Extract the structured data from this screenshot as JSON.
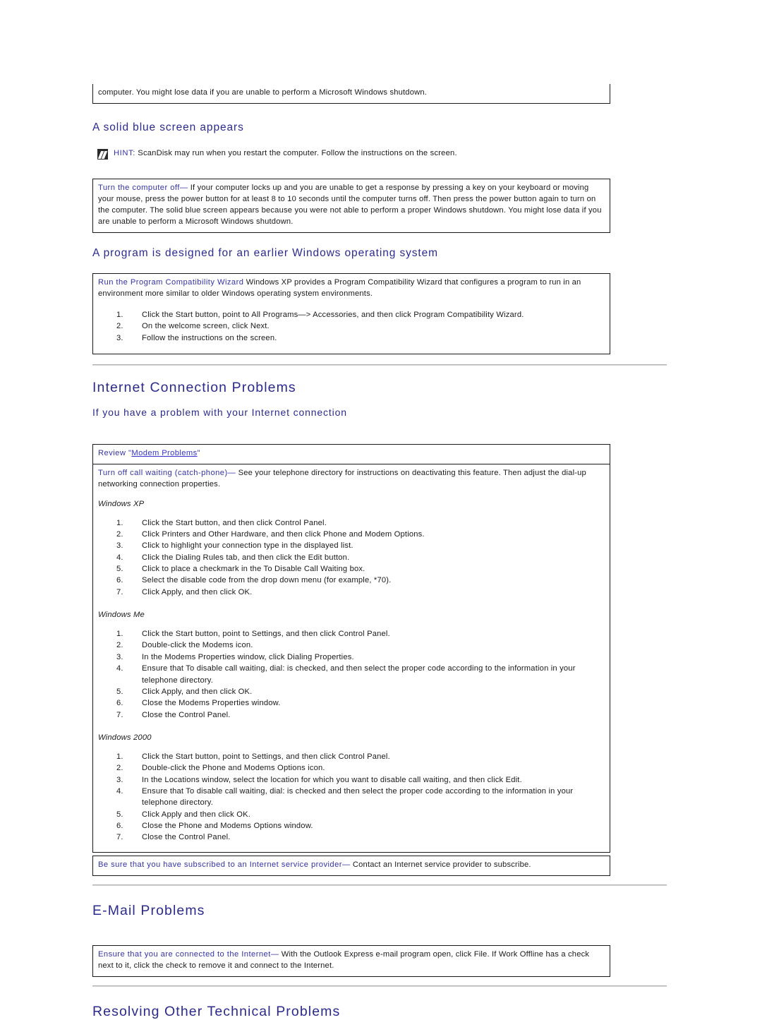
{
  "document": {
    "continued_paragraph": "computer. You might lose data if you are unable to perform a Microsoft Windows shutdown."
  },
  "blue_screen_section": {
    "heading": "A solid blue screen appears",
    "hint": {
      "icon": "note-pencil-icon",
      "keyword": "HINT:",
      "text": " ScanDisk may run when you restart the computer. Follow the instructions on the screen."
    },
    "tip": {
      "label": "Turn the computer off",
      "dash": "—",
      "body": " If your computer locks up and you are unable to get a response by pressing a key on your keyboard or moving your mouse, press the power button for at least 8 to 10 seconds until the computer turns off. Then press the power button again to turn on the computer. The solid blue screen appears because you were not able to perform a proper Windows shutdown. You might lose data if you are unable to perform a Microsoft Windows shutdown."
    }
  },
  "earlier_windows_section": {
    "heading": "A program is designed for an earlier Windows operating system",
    "tip": {
      "label": "Run the Program Compatibility Wizard",
      "body": " Windows XP provides a Program Compatibility Wizard that configures a program to run in an environment more similar to older Windows operating system environments."
    },
    "steps": [
      "Click the Start button, point to All Programs—> Accessories, and then click Program Compatibility Wizard.",
      "On the welcome screen, click Next.",
      "Follow the instructions on the screen."
    ]
  },
  "internet_section": {
    "heading": "Internet Connection Problems",
    "subheading": "If you have a problem with your Internet connection",
    "review_row": {
      "prefix": "Review \"",
      "link_text": "Modem Problems",
      "suffix": "\""
    },
    "call_waiting": {
      "label": "Turn off call waiting (catch-phone)",
      "dash": "—",
      "body": " See your telephone directory for instructions on deactivating this feature. Then adjust the dial-up networking connection properties."
    },
    "os_groups": [
      {
        "title": "Windows XP",
        "steps": [
          "Click the Start button, and then click Control Panel.",
          "Click Printers and Other Hardware, and then click Phone and Modem Options.",
          "Click to highlight your connection type in the displayed list.",
          "Click the Dialing Rules tab, and then click the Edit button.",
          "Click to place a checkmark in the To Disable Call Waiting box.",
          "Select the disable code from the drop down menu (for example, *70).",
          "Click Apply, and then click OK."
        ]
      },
      {
        "title": "Windows Me",
        "steps": [
          "Click the Start button, point to Settings, and then click Control Panel.",
          "Double-click the Modems icon.",
          "In the Modems Properties window, click Dialing Properties.",
          "Ensure that To disable call waiting, dial: is checked, and then select the proper code according to the information in your telephone directory.",
          "Click Apply, and then click OK.",
          "Close the Modems Properties window.",
          "Close the Control Panel."
        ]
      },
      {
        "title": "Windows 2000",
        "steps": [
          "Click the Start button, point to Settings, and then click Control Panel.",
          "Double-click the Phone and Modems Options icon.",
          "In the Locations window, select the location for which you want to disable call waiting, and then click Edit.",
          "Ensure that To disable call waiting, dial: is checked and then select the proper code according to the information in your telephone directory.",
          "Click Apply and then click OK.",
          "Close the Phone and Modems Options window.",
          "Close the Control Panel."
        ]
      }
    ],
    "isp_tip": {
      "label": "Be sure that you have subscribed to an Internet service provider",
      "dash": "—",
      "body": " Contact an Internet service provider to subscribe."
    }
  },
  "email_section": {
    "heading": "E-Mail Problems",
    "tip": {
      "label": "Ensure that you are connected to the Internet",
      "dash": "—",
      "body": " With the Outlook Express e-mail program open, click File. If Work Offline has a check next to it, click the check to remove it and connect to the Internet."
    }
  },
  "resolving_section": {
    "heading": "Resolving Other Technical Problems"
  },
  "colors": {
    "heading_blue": "#2b2b8f",
    "label_blue": "#3333a6",
    "link_blue": "#3333cc",
    "border_black": "#1a1a1a",
    "rule_gray": "#d4d4d4"
  }
}
